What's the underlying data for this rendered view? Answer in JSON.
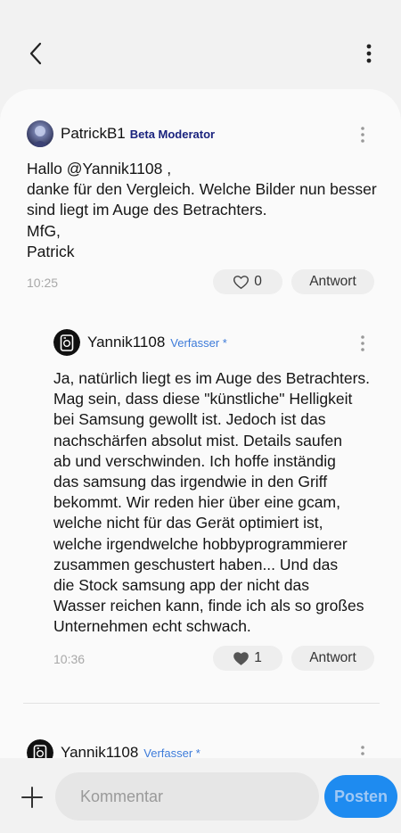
{
  "colors": {
    "accent": "#1e8bf0",
    "moderator_badge": "#1a237e",
    "author_badge": "#3d7bd9",
    "muted": "#a8a8a8"
  },
  "header": {
    "back_icon": "chevron-left-icon",
    "menu_icon": "more-vertical-icon"
  },
  "comments": [
    {
      "author": "PatrickB1",
      "role": "Beta Moderator",
      "lines": [
        "Hallo @Yannik1108 ,",
        "danke für den Vergleich. Welche Bilder nun besser",
        "sind liegt im Auge des Betrachters.",
        "MfG,",
        "Patrick"
      ],
      "time": "10:25",
      "likes": "0",
      "liked": false,
      "reply_label": "Antwort"
    },
    {
      "author": "Yannik1108",
      "role": "Verfasser *",
      "lines": [
        "Ja, natürlich liegt es im Auge des Betrachters.",
        "Mag sein, dass diese \"künstliche\" Helligkeit",
        "bei Samsung gewollt ist. Jedoch ist das",
        "nachschärfen absolut mist. Details saufen",
        "ab und verschwinden. Ich hoffe inständig",
        "das samsung das irgendwie in den Griff",
        "bekommt. Wir reden hier über eine gcam,",
        "welche nicht für das Gerät optimiert ist,",
        "welche irgendwelche hobbyprogrammierer",
        "zusammen geschustert haben... Und das",
        "die Stock samsung app der nicht das",
        "Wasser reichen kann, finde ich als so großes",
        "Unternehmen echt schwach."
      ],
      "time": "10:36",
      "likes": "1",
      "liked": true,
      "reply_label": "Antwort"
    },
    {
      "author": "Yannik1108",
      "role": "Verfasser *"
    }
  ],
  "composer": {
    "add_icon": "plus-icon",
    "placeholder": "Kommentar",
    "submit_label": "Posten"
  }
}
